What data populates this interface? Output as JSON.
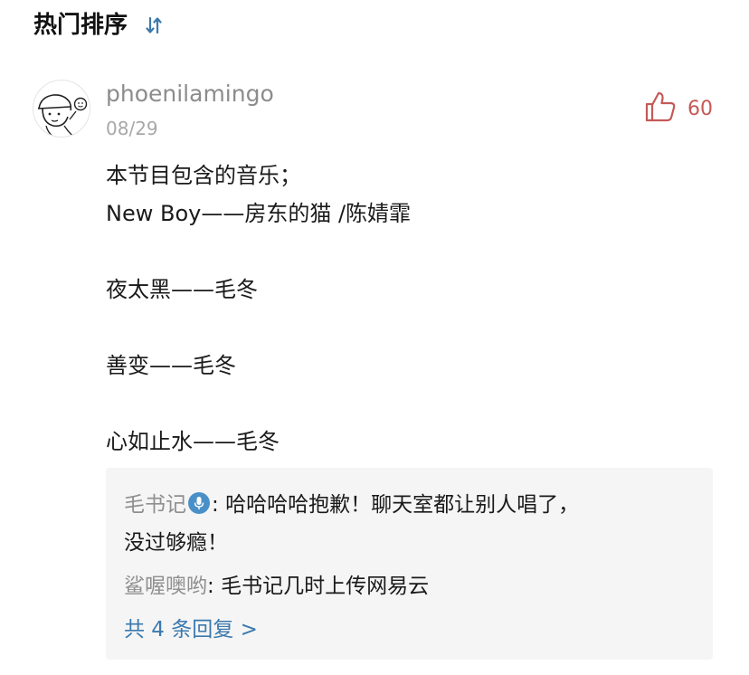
{
  "header": {
    "title": "热门排序",
    "sort_icon": "sort-arrows-icon"
  },
  "comment": {
    "avatar_icon": "cartoon-avatar-icon",
    "username": "phoenilamingo",
    "date": "08/29",
    "like_icon": "thumbs-up-icon",
    "like_count": "60",
    "lines": [
      "本节目包含的音乐；",
      "New Boy——房东的猫 /陈婧霏",
      "",
      "夜太黑——毛冬",
      "",
      "善变——毛冬",
      "",
      "心如止水——毛冬"
    ]
  },
  "replies": {
    "items": [
      {
        "name": "毛书记",
        "badge_icon": "microphone-badge-icon",
        "sep": ": ",
        "text": "哈哈哈哈抱歉！聊天室都让别人唱了，",
        "text2": "没过够瘾！"
      },
      {
        "name": "鲨喔噢哟",
        "sep": ": ",
        "text": "毛书记几时上传网易云"
      }
    ],
    "more_label": "共 4 条回复 >"
  },
  "colors": {
    "accent_blue": "#3b79ad",
    "like_red": "#c45a57",
    "muted_gray": "#8c8c8c",
    "reply_bg": "#f5f5f5"
  }
}
